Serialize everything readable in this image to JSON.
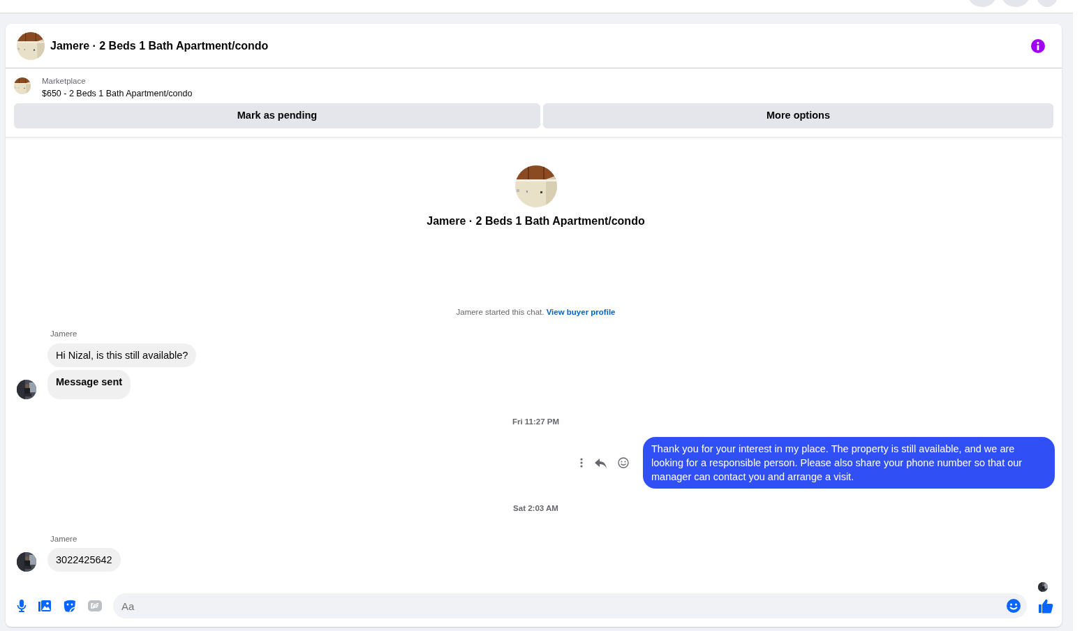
{
  "header": {
    "title": "Jamere · 2 Beds 1 Bath Apartment/condo"
  },
  "listing": {
    "source": "Marketplace",
    "summary": "$650 - 2 Beds 1 Bath Apartment/condo"
  },
  "actions": [
    "Mark as pending",
    "More options"
  ],
  "intro": {
    "title": "Jamere · 2 Beds 1 Bath Apartment/condo",
    "notice": "Jamere started this chat.",
    "link": "View buyer profile"
  },
  "messages": [
    {
      "kind": "incoming",
      "sender": "Jamere",
      "bubbles": [
        {
          "kind": "text",
          "text": "Hi Nizal, is this still available?"
        },
        {
          "kind": "notice",
          "text": "Message sent"
        }
      ]
    },
    {
      "kind": "timestamp",
      "text": "Fri 11:27 PM"
    },
    {
      "kind": "outgoing",
      "bubbles": [
        {
          "text": "Thank you for your interest in my place. The property is still available, and we are looking for a responsible person. Please also share your phone number so that our manager can contact you and arrange a visit."
        }
      ]
    },
    {
      "kind": "timestamp",
      "text": "Sat 2:03 AM"
    },
    {
      "kind": "incoming",
      "sender": "Jamere",
      "bubbles": [
        {
          "kind": "text",
          "text": "3022425642"
        }
      ]
    }
  ],
  "composer": {
    "placeholder": "Aa"
  }
}
